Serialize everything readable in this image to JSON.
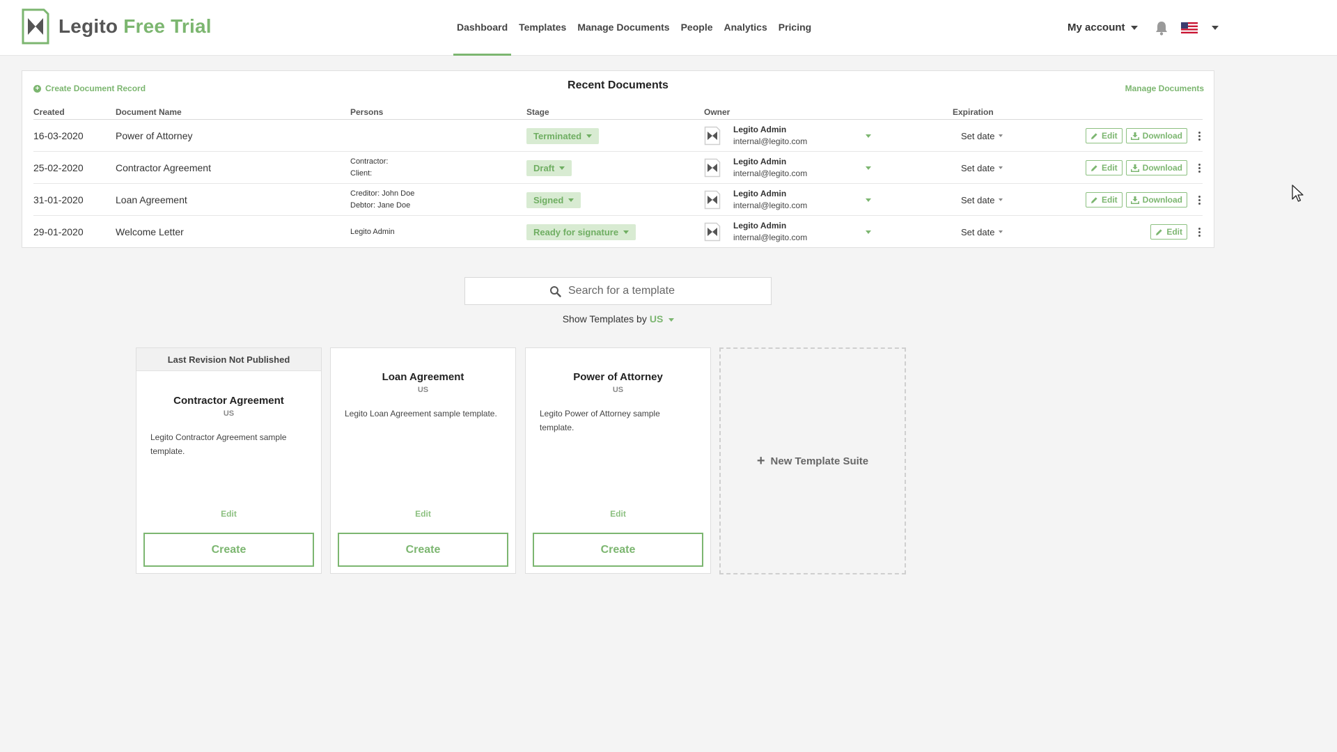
{
  "brand": {
    "name": "Legito",
    "suffix": "Free Trial"
  },
  "nav": {
    "items": [
      {
        "label": "Dashboard",
        "active": true
      },
      {
        "label": "Templates"
      },
      {
        "label": "Manage Documents"
      },
      {
        "label": "People"
      },
      {
        "label": "Analytics"
      },
      {
        "label": "Pricing"
      }
    ]
  },
  "account": {
    "label": "My account"
  },
  "recent": {
    "title": "Recent Documents",
    "create_label": "Create Document Record",
    "manage_label": "Manage Documents",
    "columns": {
      "created": "Created",
      "name": "Document Name",
      "persons": "Persons",
      "stage": "Stage",
      "owner": "Owner",
      "expiration": "Expiration"
    },
    "rows": [
      {
        "created": "16-03-2020",
        "name": "Power of Attorney",
        "persons_1": "",
        "persons_2": "",
        "stage": "Terminated",
        "owner_name": "Legito Admin",
        "owner_email": "internal@legito.com",
        "expiration": "Set date"
      },
      {
        "created": "25-02-2020",
        "name": "Contractor Agreement",
        "persons_1": "Contractor:",
        "persons_2": "Client:",
        "stage": "Draft",
        "owner_name": "Legito Admin",
        "owner_email": "internal@legito.com",
        "expiration": "Set date"
      },
      {
        "created": "31-01-2020",
        "name": "Loan Agreement",
        "persons_1": "Creditor: John Doe",
        "persons_2": "Debtor: Jane Doe",
        "stage": "Signed",
        "owner_name": "Legito Admin",
        "owner_email": "internal@legito.com",
        "expiration": "Set date"
      },
      {
        "created": "29-01-2020",
        "name": "Welcome Letter",
        "persons_1": "Legito Admin",
        "persons_2": "",
        "stage": "Ready for signature",
        "owner_name": "Legito Admin",
        "owner_email": "internal@legito.com",
        "expiration": "Set date"
      }
    ],
    "edit_label": "Edit",
    "download_label": "Download"
  },
  "search": {
    "placeholder": "Search for a template"
  },
  "show_templates": {
    "label": "Show Templates by",
    "region": "US"
  },
  "templates": [
    {
      "banner": "Last Revision Not Published",
      "title": "Contractor Agreement",
      "region": "US",
      "description": "Legito Contractor Agreement sample template.",
      "edit": "Edit",
      "create": "Create"
    },
    {
      "banner": "",
      "title": "Loan Agreement",
      "region": "US",
      "description": "Legito Loan Agreement sample template.",
      "edit": "Edit",
      "create": "Create"
    },
    {
      "banner": "",
      "title": "Power of Attorney",
      "region": "US",
      "description": "Legito Power of Attorney sample template.",
      "edit": "Edit",
      "create": "Create"
    }
  ],
  "new_template": {
    "label": "New Template Suite"
  },
  "colors": {
    "accent": "#7cb670",
    "badge_bg": "#d8ebd2",
    "page_bg": "#f4f4f4"
  },
  "icons": {
    "logo": "legito-bowtie-logo",
    "bell": "bell-icon",
    "flag": "us-flag-icon",
    "search": "search-icon",
    "edit": "pencil-icon",
    "download": "download-icon"
  }
}
